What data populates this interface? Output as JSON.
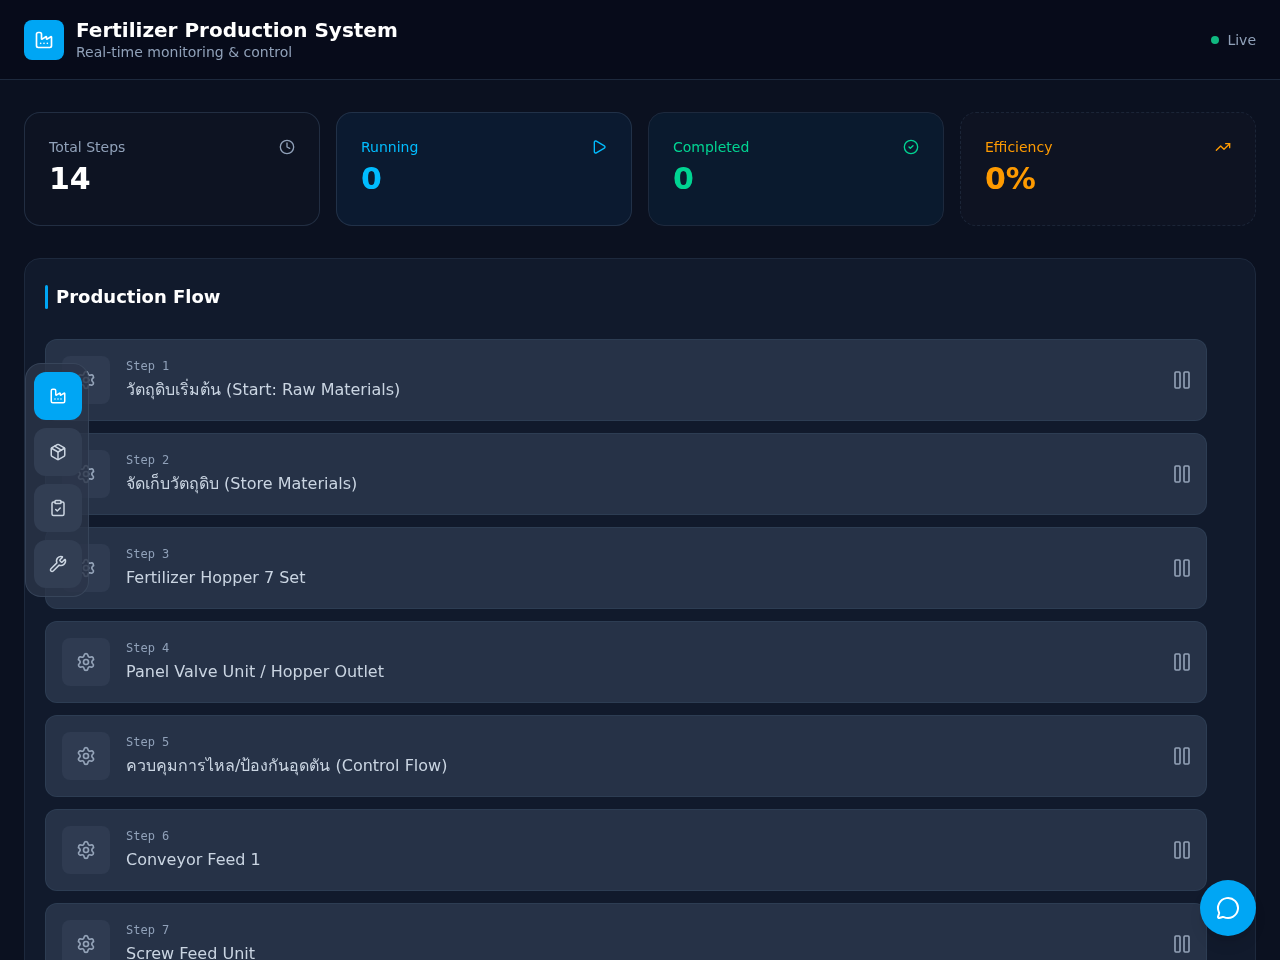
{
  "header": {
    "title": "Fertilizer Production System",
    "subtitle": "Real-time monitoring & control",
    "status": {
      "label": "Live",
      "color": "#10b981"
    }
  },
  "stats": [
    {
      "kind": "total",
      "label": "Total Steps",
      "value": "14"
    },
    {
      "kind": "running",
      "label": "Running",
      "value": "0"
    },
    {
      "kind": "completed",
      "label": "Completed",
      "value": "0"
    },
    {
      "kind": "efficiency",
      "label": "Efficiency",
      "value": "0%"
    }
  ],
  "sidebar": {
    "items": [
      {
        "kind": "factory",
        "selected": true
      },
      {
        "kind": "package",
        "selected": false
      },
      {
        "kind": "clipboard",
        "selected": false
      },
      {
        "kind": "wrench",
        "selected": false
      }
    ]
  },
  "flow": {
    "title": "Production Flow",
    "steps": [
      {
        "step": "Step 1",
        "name": "วัตถุดิบเริ่มต้น (Start: Raw Materials)"
      },
      {
        "step": "Step 2",
        "name": "จัดเก็บวัตถุดิบ (Store Materials)"
      },
      {
        "step": "Step 3",
        "name": "Fertilizer Hopper 7 Set"
      },
      {
        "step": "Step 4",
        "name": "Panel Valve Unit / Hopper Outlet"
      },
      {
        "step": "Step 5",
        "name": "ควบคุมการไหล/ป้องกันอุดตัน (Control Flow)"
      },
      {
        "step": "Step 6",
        "name": "Conveyor Feed 1"
      },
      {
        "step": "Step 7",
        "name": "Screw Feed Unit"
      }
    ]
  }
}
